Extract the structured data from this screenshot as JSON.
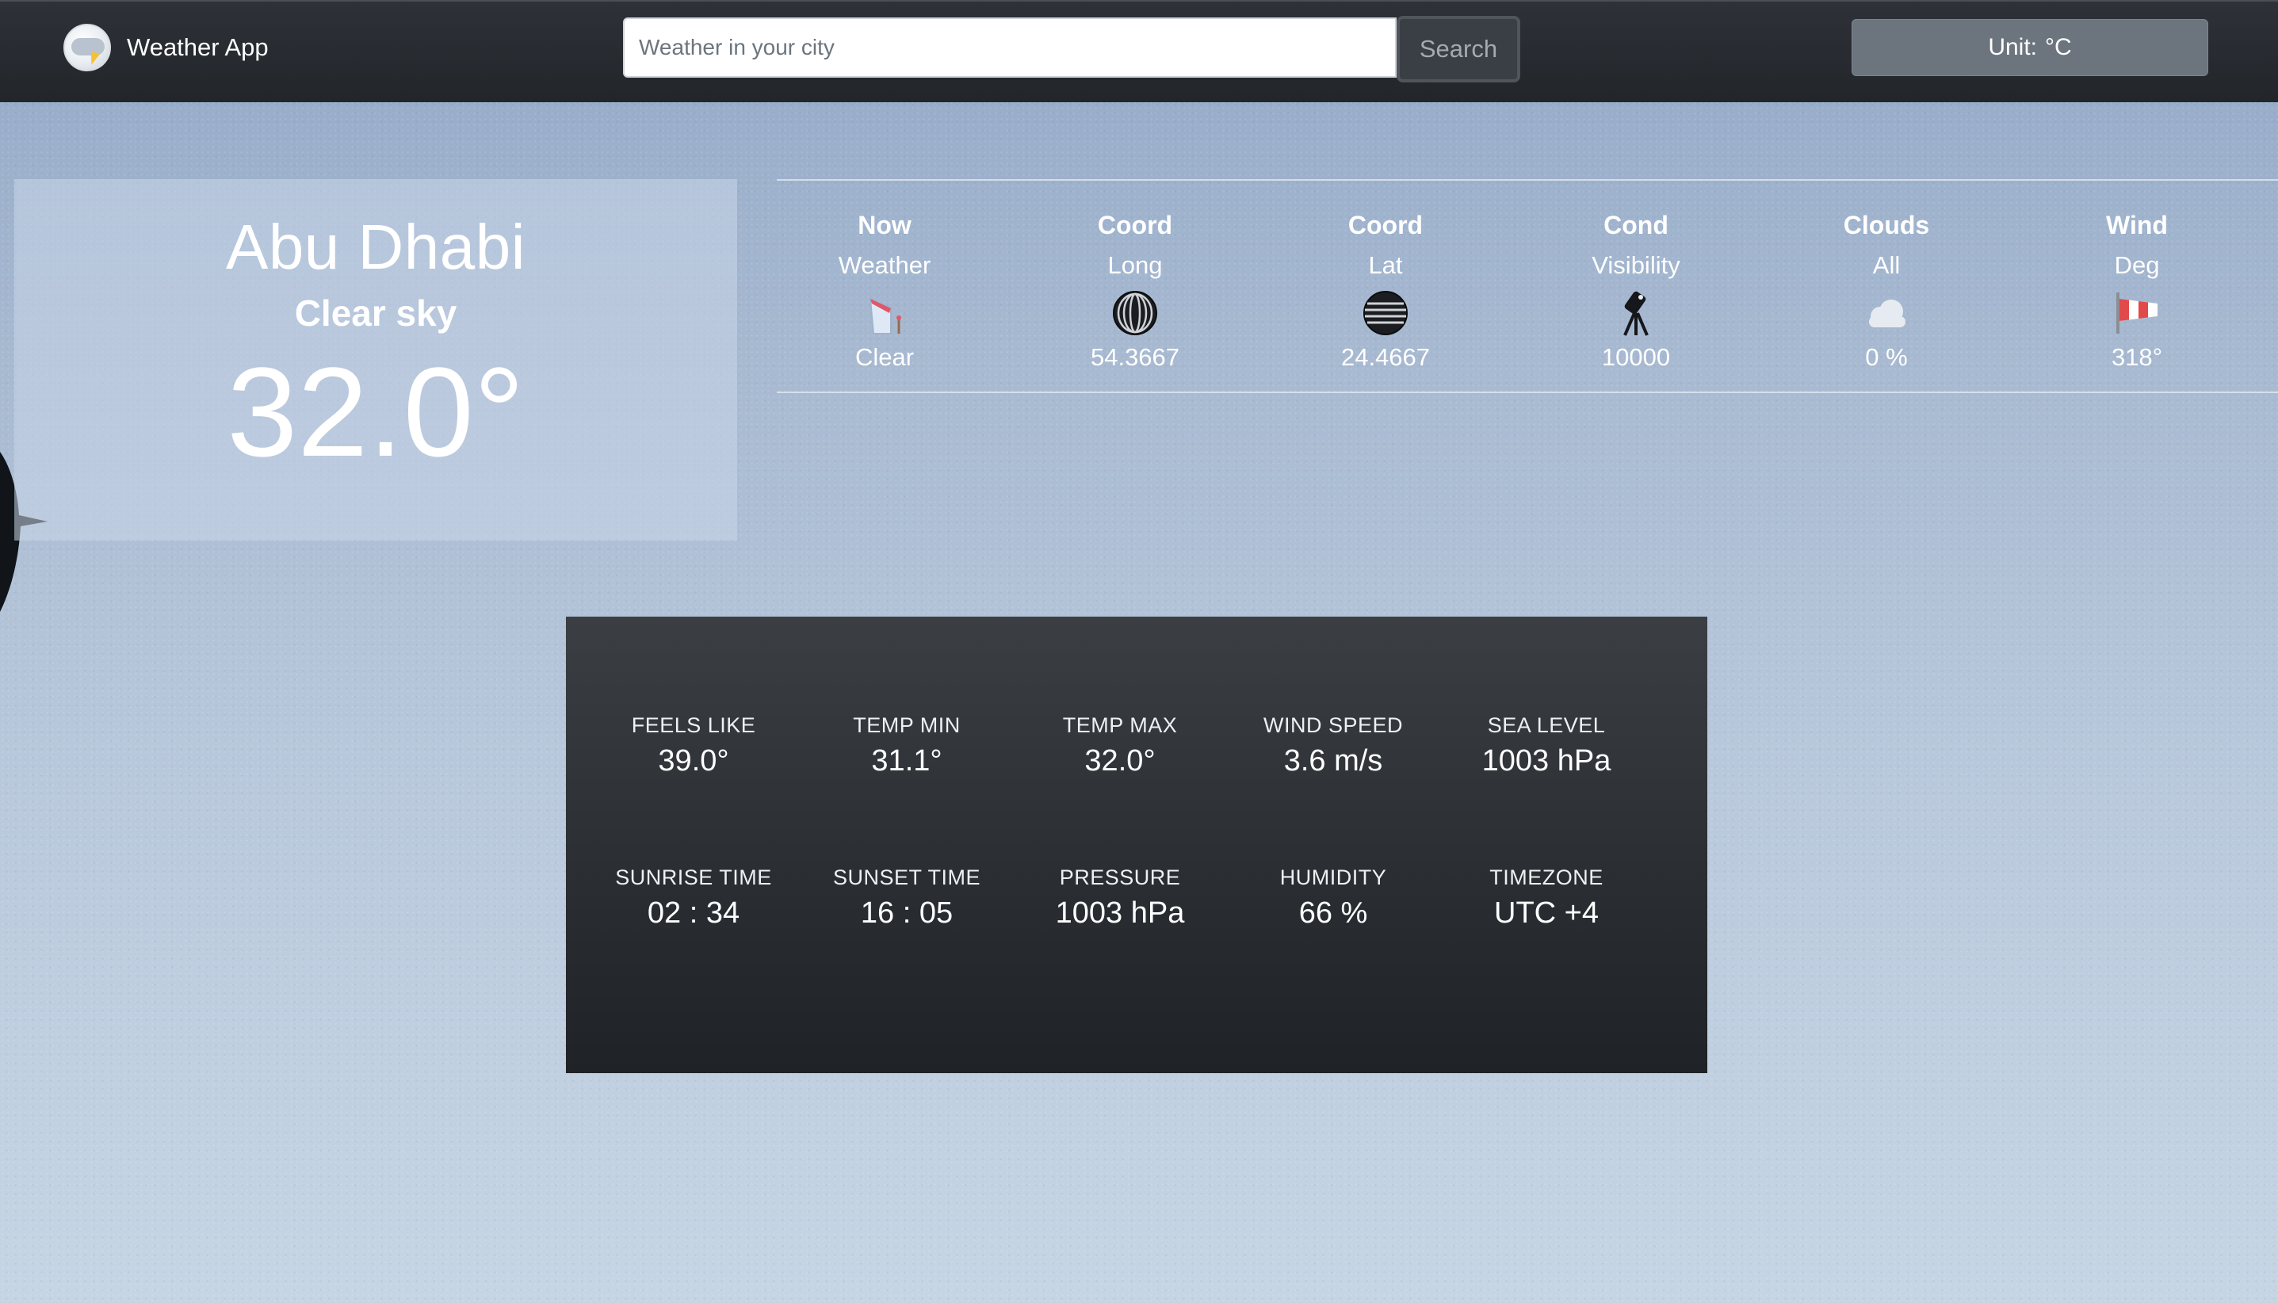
{
  "navbar": {
    "brand": "Weather App",
    "search_placeholder": "Weather in your city",
    "search_label": "Search",
    "unit_label": "Unit:",
    "unit_value": "°C"
  },
  "city": {
    "name": "Abu Dhabi",
    "description": "Clear sky",
    "temperature": "32.0°"
  },
  "info": [
    {
      "title": "Now",
      "sub": "Weather",
      "icon": "weather-now-icon",
      "value": "Clear"
    },
    {
      "title": "Coord",
      "sub": "Long",
      "icon": "globe-longitude-icon",
      "value": "54.3667"
    },
    {
      "title": "Coord",
      "sub": "Lat",
      "icon": "globe-latitude-icon",
      "value": "24.4667"
    },
    {
      "title": "Cond",
      "sub": "Visibility",
      "icon": "telescope-icon",
      "value": "10000"
    },
    {
      "title": "Clouds",
      "sub": "All",
      "icon": "cloud-icon",
      "value": "0 %"
    },
    {
      "title": "Wind",
      "sub": "Deg",
      "icon": "windsock-icon",
      "value": "318°"
    }
  ],
  "details": [
    {
      "label": "FEELS LIKE",
      "value": "39.0°"
    },
    {
      "label": "TEMP MIN",
      "value": "31.1°"
    },
    {
      "label": "TEMP MAX",
      "value": "32.0°"
    },
    {
      "label": "WIND SPEED",
      "value": "3.6 m/s"
    },
    {
      "label": "SEA LEVEL",
      "value": "1003 hPa"
    },
    {
      "label": "SUNRISE TIME",
      "value": "02 : 34"
    },
    {
      "label": "SUNSET TIME",
      "value": "16 : 05"
    },
    {
      "label": "PRESSURE",
      "value": "1003 hPa"
    },
    {
      "label": "HUMIDITY",
      "value": "66 %"
    },
    {
      "label": "TIMEZONE",
      "value": "UTC +4"
    }
  ]
}
